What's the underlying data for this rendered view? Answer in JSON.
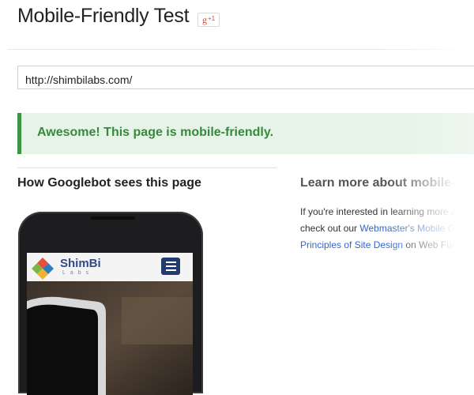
{
  "page": {
    "title": "Mobile-Friendly Test",
    "share_button": {
      "g": "g",
      "plus": "+1"
    }
  },
  "url_input": {
    "value": "http://shimbilabs.com/"
  },
  "result": {
    "message": "Awesome! This page is mobile-friendly."
  },
  "preview": {
    "heading": "How Googlebot sees this page",
    "site_logo_name": "ShimBi",
    "site_logo_sub": "Labs"
  },
  "learn_more": {
    "heading": "Learn more about mobile-fr",
    "line1": "If you're interested in learning more ab",
    "line2_prefix": "check out our ",
    "line2_link": "Webmaster's Mobile Gu",
    "line3_link": "Principles of Site Design",
    "line3_suffix": " on Web Funda"
  },
  "colors": {
    "success_bg": "#e6f4e7",
    "success_border": "#3d9442",
    "success_text": "#38883d",
    "link": "#3567c4",
    "gplus_red": "#dd4b39",
    "logo_navy": "#2f4a85"
  },
  "icons": {
    "share": "google-plus-one-icon",
    "menu": "hamburger-menu-icon",
    "logo": "diamond-logo-icon"
  }
}
